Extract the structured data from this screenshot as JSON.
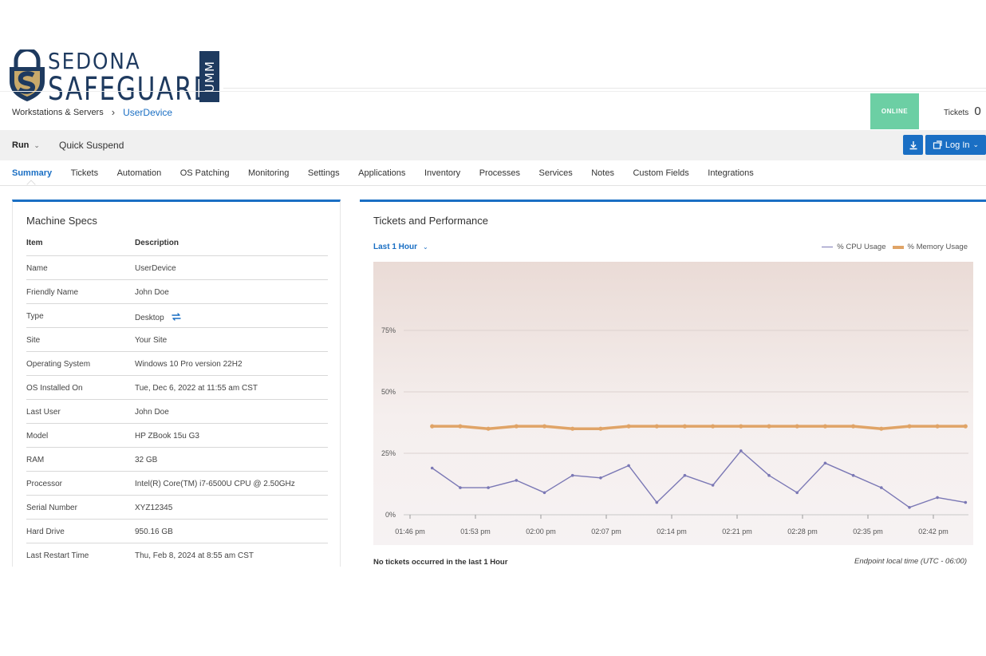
{
  "logo": {
    "line1": "SEDONA",
    "line2": "SAFEGUARD",
    "badge": "UMM"
  },
  "breadcrumb": {
    "parent": "Workstations & Servers",
    "current": "UserDevice"
  },
  "status": {
    "label": "ONLINE",
    "color": "#6ccfa4"
  },
  "tickets": {
    "label": "Tickets",
    "count": "0"
  },
  "toolbar": {
    "run_label": "Run",
    "quick_suspend_label": "Quick Suspend",
    "login_label": "Log In"
  },
  "tabs": [
    "Summary",
    "Tickets",
    "Automation",
    "OS Patching",
    "Monitoring",
    "Settings",
    "Applications",
    "Inventory",
    "Processes",
    "Services",
    "Notes",
    "Custom Fields",
    "Integrations"
  ],
  "machine_specs": {
    "title": "Machine Specs",
    "col_item": "Item",
    "col_desc": "Description",
    "rows": [
      {
        "k": "Name",
        "v": "UserDevice"
      },
      {
        "k": "Friendly Name",
        "v": "John Doe"
      },
      {
        "k": "Type",
        "v": "Desktop",
        "icon": "swap-icon"
      },
      {
        "k": "Site",
        "v": "Your Site"
      },
      {
        "k": "Operating System",
        "v": "Windows 10 Pro version 22H2"
      },
      {
        "k": "OS Installed On",
        "v": "Tue, Dec 6, 2022 at 11:55 am CST"
      },
      {
        "k": "Last User",
        "v": "John Doe"
      },
      {
        "k": "Model",
        "v": "HP ZBook 15u G3"
      },
      {
        "k": "RAM",
        "v": "32 GB"
      },
      {
        "k": "Processor",
        "v": "Intel(R) Core(TM) i7-6500U CPU @ 2.50GHz"
      },
      {
        "k": "Serial Number",
        "v": "XYZ12345"
      },
      {
        "k": "Hard Drive",
        "v": "950.16 GB"
      },
      {
        "k": "Last Restart Time",
        "v": "Thu, Feb 8, 2024 at 8:55 am CST"
      }
    ]
  },
  "performance": {
    "title": "Tickets and Performance",
    "range_label": "Last 1 Hour",
    "no_tickets": "No tickets occurred in the last 1 Hour",
    "tz_note": "Endpoint local time (UTC - 06:00)"
  },
  "chart_data": {
    "type": "line",
    "x_ticks": [
      "01:46 pm",
      "01:53 pm",
      "02:00 pm",
      "02:07 pm",
      "02:14 pm",
      "02:21 pm",
      "02:28 pm",
      "02:35 pm",
      "02:42 pm"
    ],
    "y_ticks": [
      "0%",
      "25%",
      "50%",
      "75%"
    ],
    "ylim": [
      0,
      100
    ],
    "x_minutes": [
      1,
      4,
      7,
      10,
      13,
      16,
      19,
      22,
      25,
      28,
      31,
      34,
      37,
      40,
      43,
      46,
      49,
      52,
      55,
      58
    ],
    "series": [
      {
        "name": "% CPU Usage",
        "color": "#7b78b5",
        "values": [
          19,
          11,
          11,
          14,
          9,
          16,
          15,
          20,
          5,
          16,
          12,
          26,
          16,
          9,
          21,
          16,
          11,
          3,
          7,
          5
        ]
      },
      {
        "name": "% Memory Usage",
        "color": "#e0a467",
        "values": [
          36,
          36,
          35,
          36,
          36,
          35,
          35,
          36,
          36,
          36,
          36,
          36,
          36,
          36,
          36,
          36,
          35,
          36,
          36,
          36
        ]
      }
    ],
    "legend_position": "top-right",
    "grid": true
  }
}
